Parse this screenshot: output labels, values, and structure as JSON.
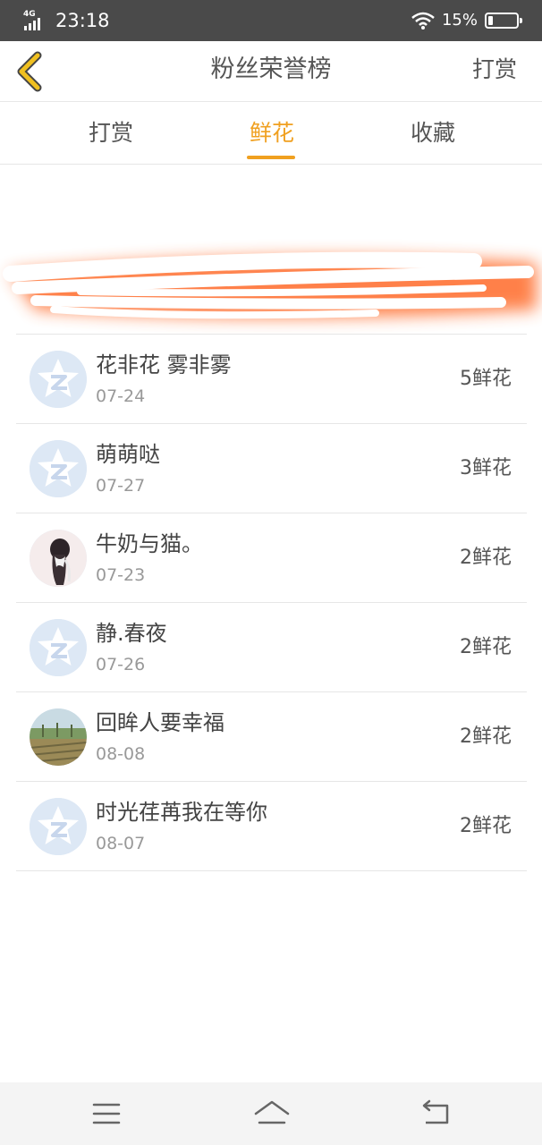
{
  "status_bar": {
    "network": "4G",
    "time": "23:18",
    "battery": "15%",
    "battery_level": 0.15
  },
  "header": {
    "title": "粉丝荣誉榜",
    "action": "打赏",
    "back_icon": "chevron-left-icon"
  },
  "tabs": [
    {
      "label": "打赏",
      "active": false
    },
    {
      "label": "鲜花",
      "active": true
    },
    {
      "label": "收藏",
      "active": false
    }
  ],
  "fans": [
    {
      "name": "花非花 雾非雾",
      "date": "07-24",
      "amount": "5鲜花",
      "avatar": "default-qq-avatar"
    },
    {
      "name": "萌萌哒",
      "date": "07-27",
      "amount": "3鲜花",
      "avatar": "default-qq-avatar"
    },
    {
      "name": "牛奶与猫。",
      "date": "07-23",
      "amount": "2鲜花",
      "avatar": "girl-photo-avatar"
    },
    {
      "name": "静.春夜",
      "date": "07-26",
      "amount": "2鲜花",
      "avatar": "default-qq-avatar"
    },
    {
      "name": "回眸人要幸福",
      "date": "08-08",
      "amount": "2鲜花",
      "avatar": "landscape-photo-avatar"
    },
    {
      "name": "时光荏苒我在等你",
      "date": "08-07",
      "amount": "2鲜花",
      "avatar": "default-qq-avatar"
    }
  ],
  "colors": {
    "accent": "#f0a020",
    "status_bar": "#4a4a4a",
    "back_icon": "#f0c020"
  },
  "nav": {
    "menu_icon": "menu-icon",
    "home_icon": "home-icon",
    "back_icon": "return-icon"
  }
}
